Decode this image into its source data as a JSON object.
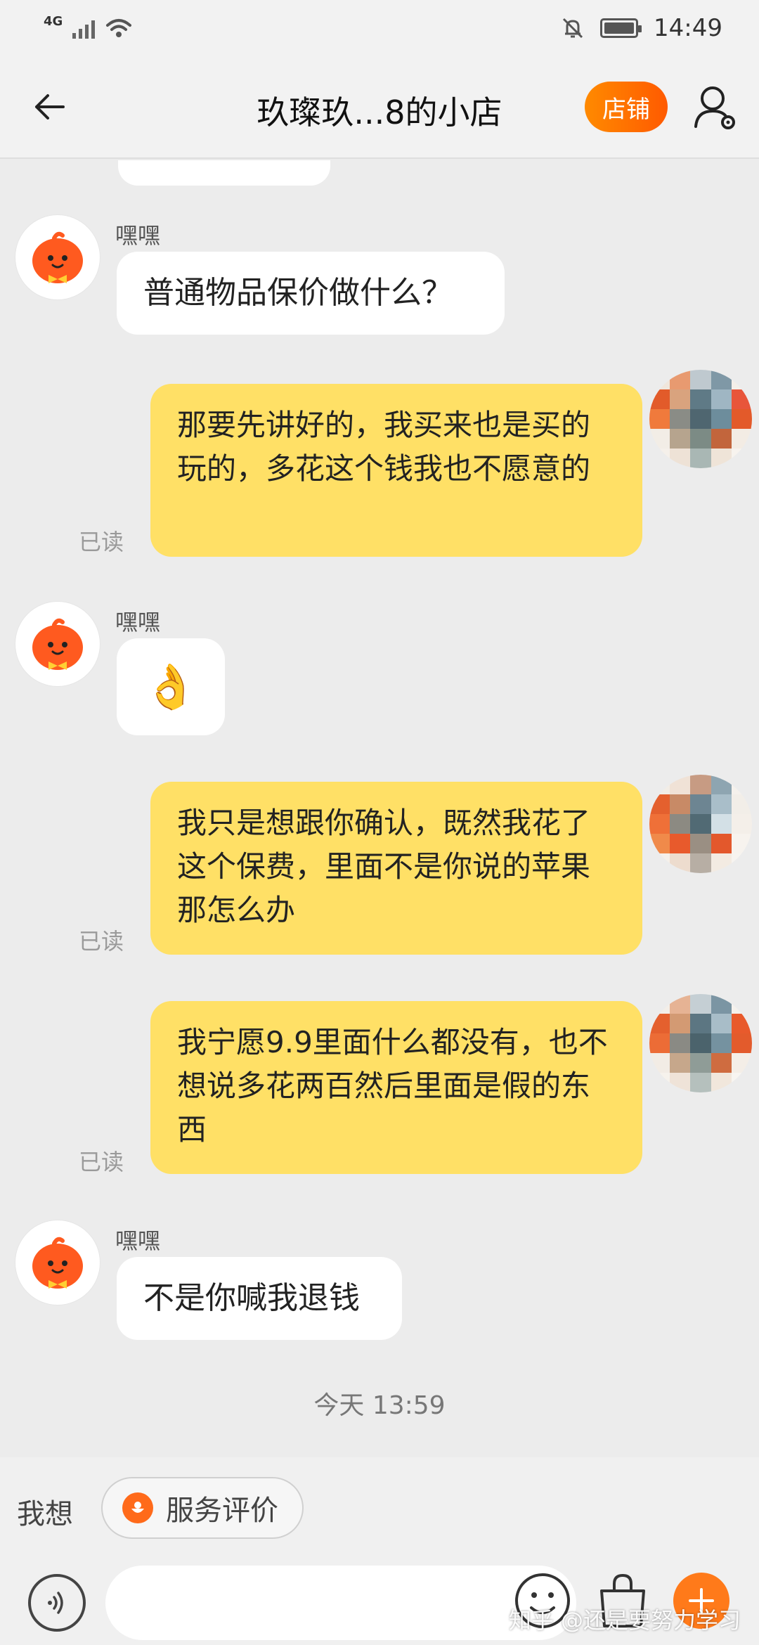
{
  "status_bar": {
    "network": "4G",
    "time": "14:49"
  },
  "header": {
    "title": "玖璨玖...8的小店",
    "shop_button": "店铺"
  },
  "messages": [
    {
      "sender": "嘿嘿",
      "text": "普通物品保价做什么？"
    },
    {
      "read": "已读",
      "text": "那要先讲好的，我买来也是买的玩的，多花这个钱我也不愿意的"
    },
    {
      "sender": "嘿嘿",
      "emoji": "👌"
    },
    {
      "read": "已读",
      "text": "我只是想跟你确认，既然我花了这个保费，里面不是你说的苹果那怎么办"
    },
    {
      "read": "已读",
      "text": "我宁愿9.9里面什么都没有，也不想说多花两百然后里面是假的东西"
    },
    {
      "sender": "嘿嘿",
      "text": "不是你喊我退钱"
    }
  ],
  "timestamp": "今天  13:59",
  "quick_bar": {
    "label": "我想",
    "chip": "服务评价"
  },
  "input": {
    "placeholder": ""
  },
  "watermark": "知乎 @还是要努力学习",
  "colors": {
    "accent": "#ff6a00",
    "outgoing_bubble": "#ffe066",
    "incoming_bubble": "#ffffff",
    "background": "#ececec"
  },
  "icons": {
    "back": "arrow-left-icon",
    "profile": "user-settings-icon",
    "voice": "voice-icon",
    "emoji": "smiley-icon",
    "bag": "shopping-bag-icon",
    "plus": "plus-icon",
    "chip": "flower-icon"
  }
}
